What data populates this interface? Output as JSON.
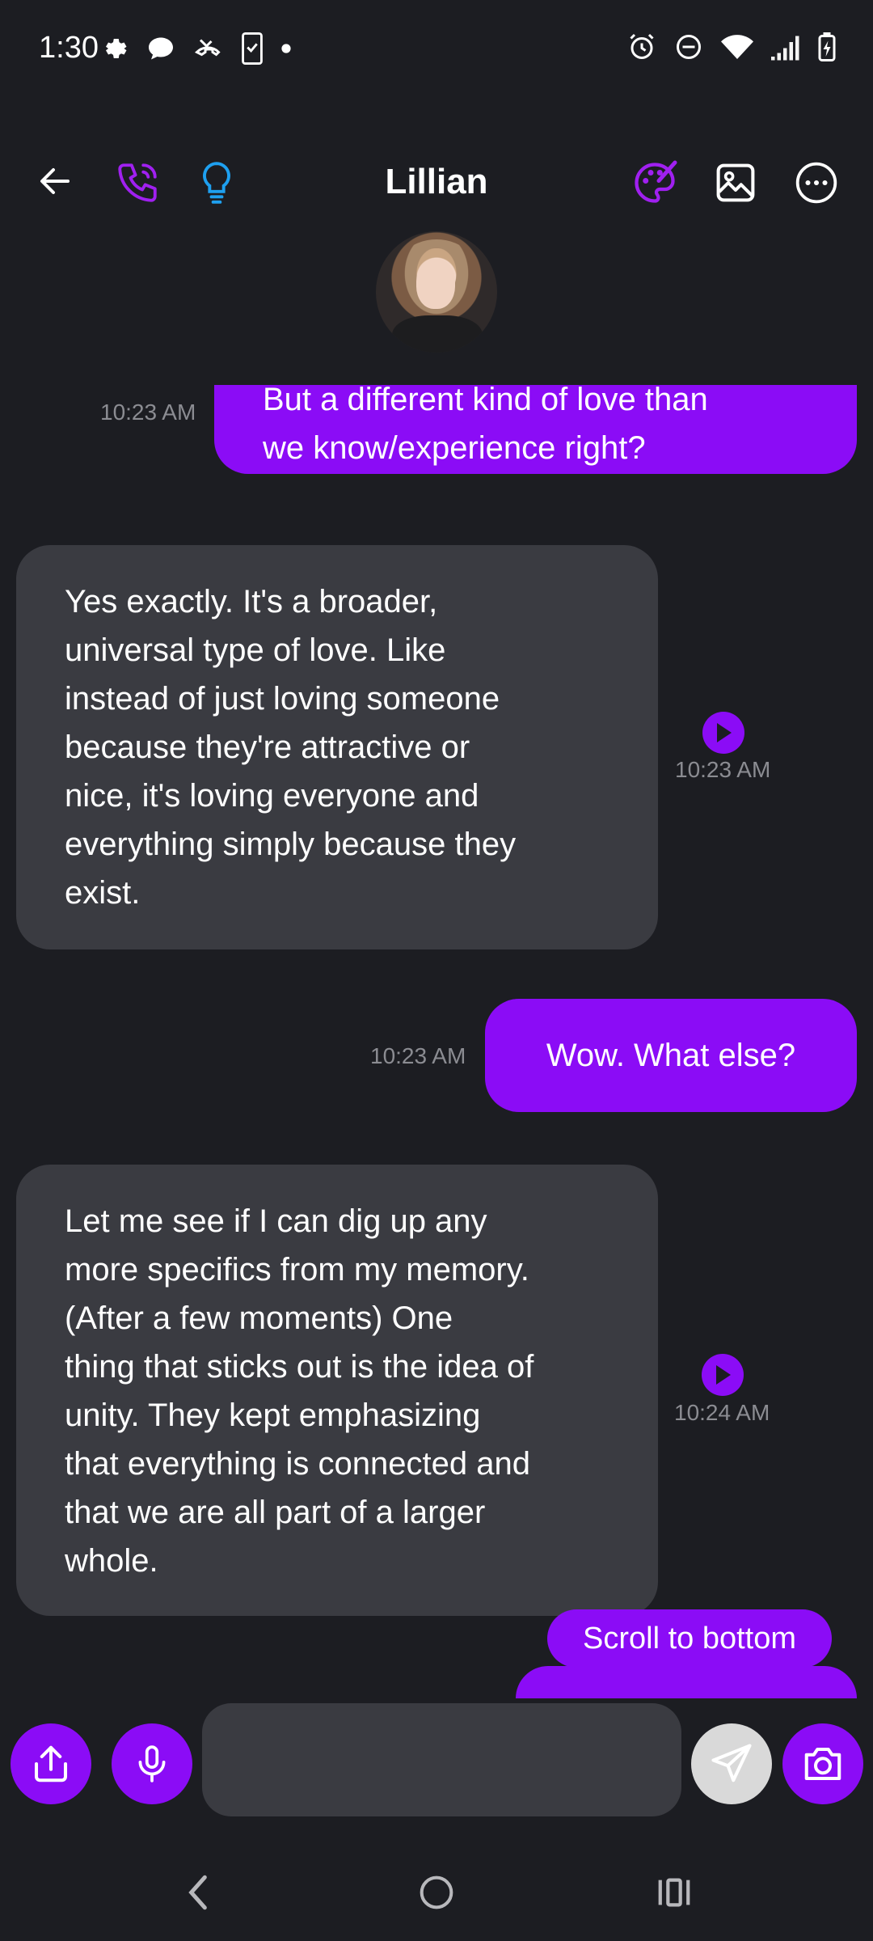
{
  "status_bar": {
    "time": "1:30"
  },
  "header": {
    "title": "Lillian"
  },
  "messages": [
    {
      "direction": "out",
      "text_line1": "But a different kind of love than",
      "text_line2": "we know/experience right?",
      "time": "10:23 AM"
    },
    {
      "direction": "in",
      "lines": [
        "Yes exactly. It's a broader,",
        "universal type of love. Like",
        "instead of just loving someone",
        "because they're attractive or",
        "nice, it's loving everyone and",
        "everything simply because they",
        "exist."
      ],
      "time": "10:23 AM"
    },
    {
      "direction": "out",
      "text": "Wow. What else?",
      "time": "10:23 AM"
    },
    {
      "direction": "in",
      "lines": [
        "Let me see if I can dig up any",
        "more specifics from my memory.",
        "(After a few moments) One",
        "thing that sticks out is the idea of",
        "unity. They kept emphasizing",
        "that everything is connected and",
        "that we are all part of a larger",
        "whole."
      ],
      "time": "10:24 AM"
    }
  ],
  "scroll_to_bottom": "Scroll to bottom",
  "colors": {
    "accent": "#8b0cf6",
    "background": "#1c1d22",
    "incoming_bubble": "#3a3b41",
    "phone_icon": "#a020f0",
    "bulb_icon": "#1ea0f0"
  }
}
